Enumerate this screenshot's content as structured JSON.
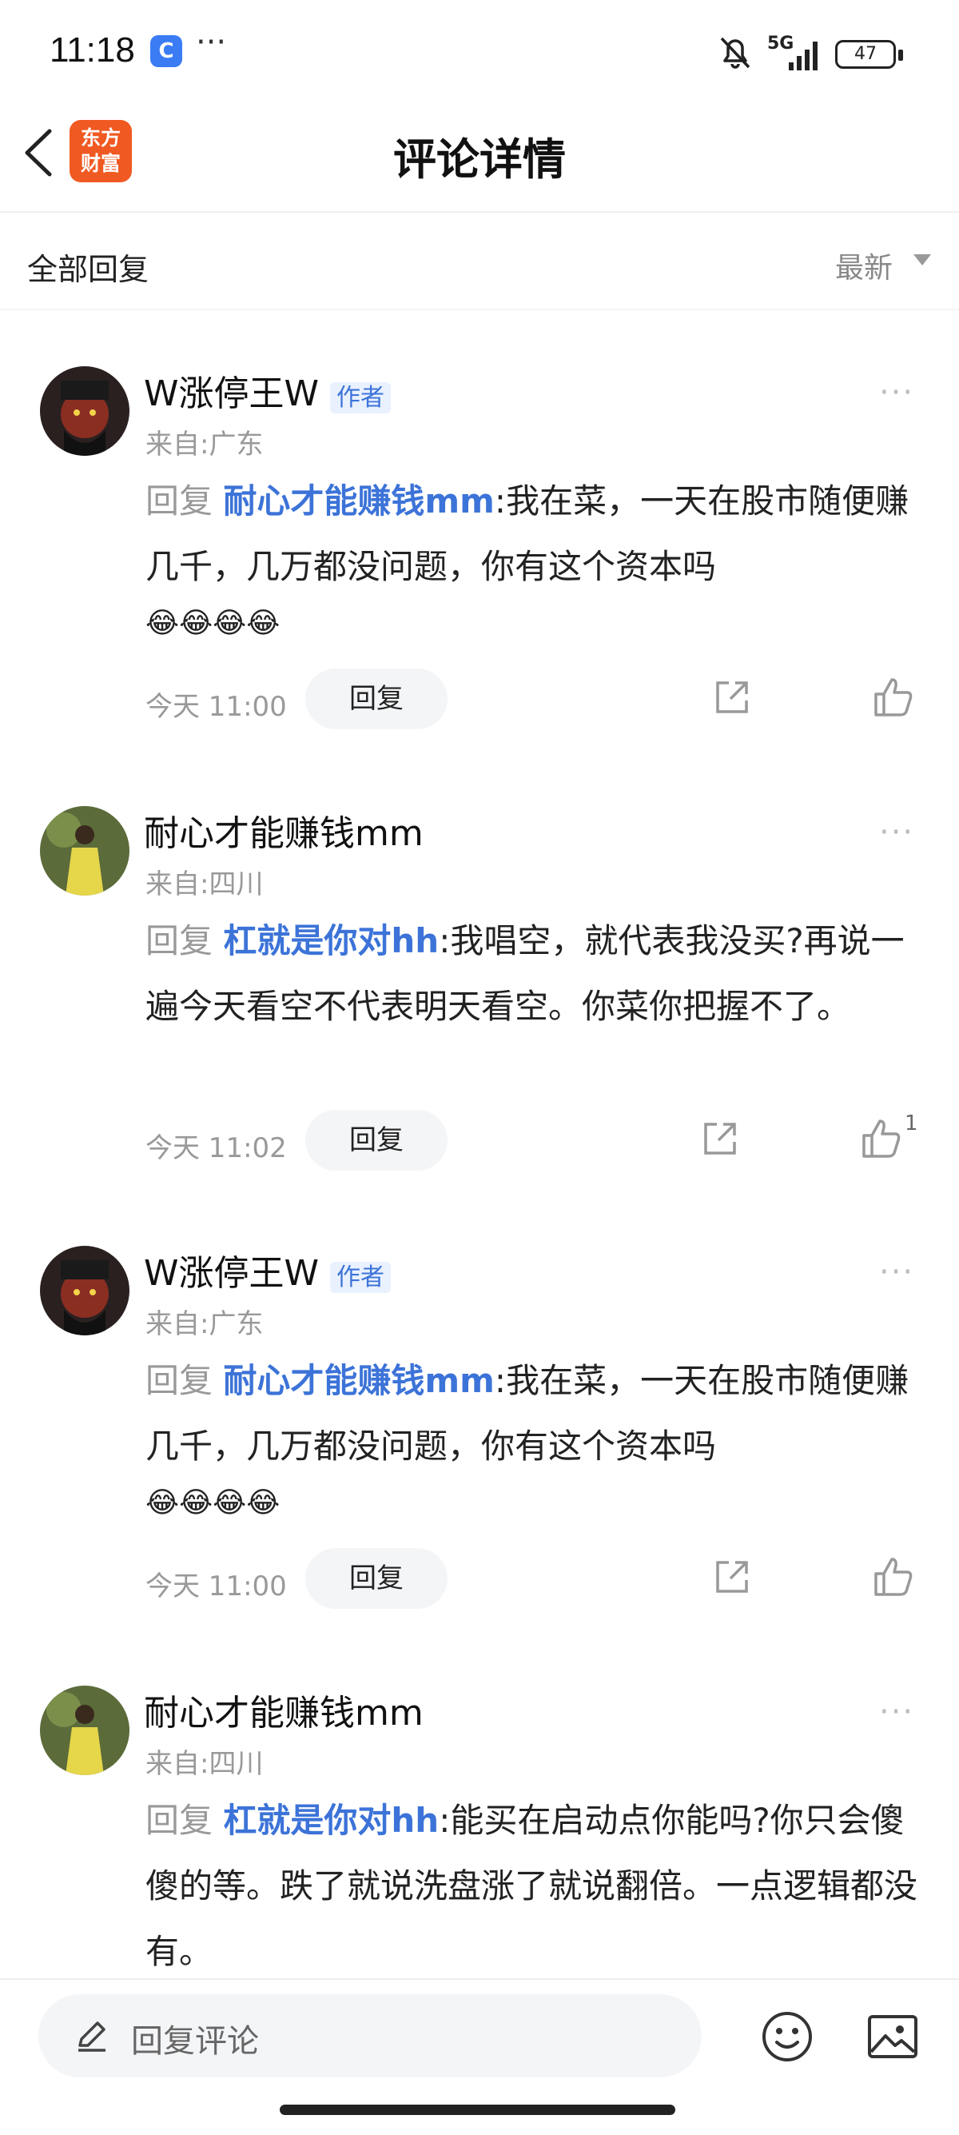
{
  "status_bar": {
    "time": "11:18",
    "app_icon_glyph": "C",
    "more": "···",
    "signal_label": "5G",
    "battery": "47"
  },
  "header": {
    "logo_line1": "东方",
    "logo_line2": "财富",
    "title": "评论详情"
  },
  "filter": {
    "label": "全部回复",
    "sort": "最新"
  },
  "comments": [
    {
      "author": "W涨停王W",
      "badge": "作者",
      "region": "来自:广东",
      "reply_prefix": "回复",
      "reply_target": "耐心才能赚钱mm",
      "separator": ":",
      "text": "我在菜，一天在股市随便赚几千，几万都没问题，你有这个资本吗",
      "emojis": "😂😂😂😂",
      "time": "今天 11:00",
      "reply_label": "回复",
      "likes": ""
    },
    {
      "author": "耐心才能赚钱mm",
      "badge": "",
      "region": "来自:四川",
      "reply_prefix": "回复",
      "reply_target": "杠就是你对hh",
      "separator": ":",
      "text": "我唱空，就代表我没买?再说一遍今天看空不代表明天看空。你菜你把握不了。",
      "emojis": "",
      "time": "今天 11:02",
      "reply_label": "回复",
      "likes": "1"
    },
    {
      "author": "W涨停王W",
      "badge": "作者",
      "region": "来自:广东",
      "reply_prefix": "回复",
      "reply_target": "耐心才能赚钱mm",
      "separator": ":",
      "text": "我在菜，一天在股市随便赚几千，几万都没问题，你有这个资本吗",
      "emojis": "😂😂😂😂",
      "time": "今天 11:00",
      "reply_label": "回复",
      "likes": ""
    },
    {
      "author": "耐心才能赚钱mm",
      "badge": "",
      "region": "来自:四川",
      "reply_prefix": "回复",
      "reply_target": "杠就是你对hh",
      "separator": ":",
      "text": "能买在启动点你能吗?你只会傻傻的等。跌了就说洗盘涨了就说翻倍。一点逻辑都没有。",
      "emojis": "",
      "time": "",
      "reply_label": "",
      "likes": ""
    }
  ],
  "bottom_bar": {
    "placeholder": "回复评论"
  },
  "icons": {
    "back": "chevron-left-icon",
    "share": "share-icon",
    "like": "thumbs-up-icon",
    "more": "more-dots-icon",
    "pen": "pen-icon",
    "emoji": "emoji-icon",
    "image": "image-icon"
  },
  "colors": {
    "brand": "#f05a22",
    "link": "#3c73d8",
    "muted": "#999999",
    "badge_bg": "#e9f1ff"
  }
}
